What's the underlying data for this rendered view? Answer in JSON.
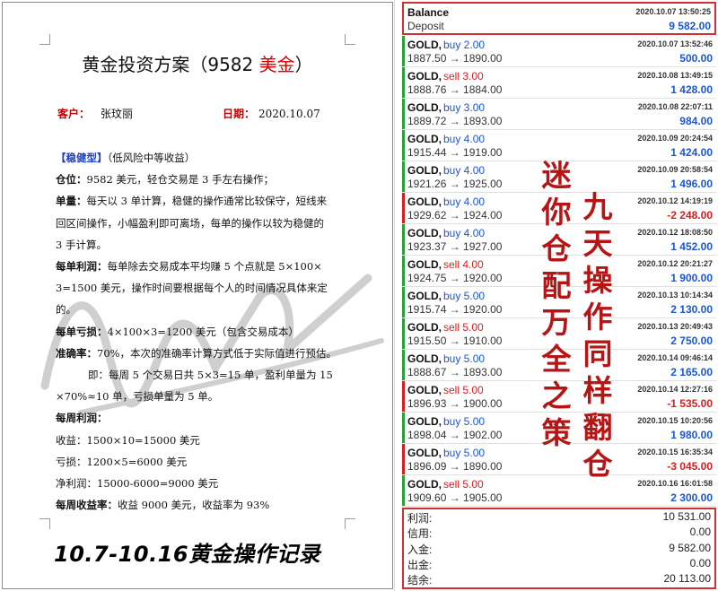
{
  "document": {
    "title_prefix": "黄金投资方案（9582 ",
    "title_red": "美金",
    "title_suffix": "）",
    "client_label": "客户：",
    "client_value": "张玟丽",
    "date_label": "日期：",
    "date_value": "2020.10.07",
    "lines": {
      "plan": "【稳健型】",
      "plan_note": "（低风险中等收益）",
      "position_label": "仓位：",
      "position_text": "9582 美元，轻仓交易是 3 手左右操作；",
      "unit_label": "单量：",
      "unit_text_1": "每天以 3 单计算，稳健的操作通常比较保守，短线来",
      "unit_text_2": "回区间操作，小幅盈利即可离场，每单的操作以较为稳健的",
      "unit_text_3": "3 手计算。",
      "unit_profit_label": "每单利润：",
      "unit_profit_text_1": "每单除去交易成本平均赚 5 个点就是 5×100×",
      "unit_profit_text_2": "3=1500 美元，操作时间要根据每个人的时间情况具体来定",
      "unit_profit_text_3": "的。",
      "unit_loss_label": "每单亏损：",
      "unit_loss_text": "4×100×3=1200 美元（包含交易成本）",
      "accuracy_label": "准确率：",
      "accuracy_text": "70%，本次的准确率计算方式低于实际值进行预估。",
      "accuracy_detail_1": "即：每周 5 个交易日共 5×3=15 单，盈利单量为 15",
      "accuracy_detail_2": "×70%≈10 单，亏损单量为 5 单。",
      "weekly_label": "每周利润：",
      "income": "收益：1500×10=15000 美元",
      "loss": "亏损：1200×5=6000 美元",
      "net": "净利润：15000-6000=9000 美元",
      "weekly_rate_label": "每周收益率：",
      "weekly_rate_text": "收益 9000 美元，收益率为 93%"
    },
    "footer": "10.7-10.16黄金操作记录"
  },
  "calligraphy": {
    "left_column": [
      "迷",
      "你",
      "仓",
      "配",
      "万",
      "全",
      "之",
      "策"
    ],
    "right_column": [
      "九",
      "天",
      "操",
      "作",
      "同",
      "样",
      "翻",
      "仓"
    ]
  },
  "balance": {
    "title": "Balance",
    "subtitle": "Deposit",
    "date": "2020.10.07 13:50:25",
    "amount": "9 582.00"
  },
  "trades": [
    {
      "symbol": "GOLD,",
      "side": "buy 2.00",
      "type": "buy",
      "prices": "1887.50 → 1890.00",
      "date": "2020.10.07 13:52:46",
      "profit": "500.00",
      "positive": true
    },
    {
      "symbol": "GOLD,",
      "side": "sell 3.00",
      "type": "sell",
      "prices": "1888.76 → 1884.00",
      "date": "2020.10.08 13:49:15",
      "profit": "1 428.00",
      "positive": true
    },
    {
      "symbol": "GOLD,",
      "side": "buy 3.00",
      "type": "buy",
      "prices": "1889.72 → 1893.00",
      "date": "2020.10.08 22:07:11",
      "profit": "984.00",
      "positive": true
    },
    {
      "symbol": "GOLD,",
      "side": "buy 4.00",
      "type": "buy",
      "prices": "1915.44 → 1919.00",
      "date": "2020.10.09 20:24:54",
      "profit": "1 424.00",
      "positive": true
    },
    {
      "symbol": "GOLD,",
      "side": "buy 4.00",
      "type": "buy",
      "prices": "1921.26 → 1925.00",
      "date": "2020.10.09 20:58:54",
      "profit": "1 496.00",
      "positive": true
    },
    {
      "symbol": "GOLD,",
      "side": "buy 4.00",
      "type": "buy",
      "prices": "1929.62 → 1924.00",
      "date": "2020.10.12 14:19:19",
      "profit": "-2 248.00",
      "positive": false
    },
    {
      "symbol": "GOLD,",
      "side": "buy 4.00",
      "type": "buy",
      "prices": "1923.37 → 1927.00",
      "date": "2020.10.12 18:08:50",
      "profit": "1 452.00",
      "positive": true
    },
    {
      "symbol": "GOLD,",
      "side": "sell 4.00",
      "type": "sell",
      "prices": "1924.75 → 1920.00",
      "date": "2020.10.12 20:21:27",
      "profit": "1 900.00",
      "positive": true
    },
    {
      "symbol": "GOLD,",
      "side": "buy 5.00",
      "type": "buy",
      "prices": "1915.74 → 1920.00",
      "date": "2020.10.13 10:14:34",
      "profit": "2 130.00",
      "positive": true
    },
    {
      "symbol": "GOLD,",
      "side": "sell 5.00",
      "type": "sell",
      "prices": "1915.50 → 1910.00",
      "date": "2020.10.13 20:49:43",
      "profit": "2 750.00",
      "positive": true
    },
    {
      "symbol": "GOLD,",
      "side": "buy 5.00",
      "type": "buy",
      "prices": "1888.67 → 1893.00",
      "date": "2020.10.14 09:46:14",
      "profit": "2 165.00",
      "positive": true
    },
    {
      "symbol": "GOLD,",
      "side": "sell 5.00",
      "type": "sell",
      "prices": "1896.93 → 1900.00",
      "date": "2020.10.14 12:27:16",
      "profit": "-1 535.00",
      "positive": false
    },
    {
      "symbol": "GOLD,",
      "side": "buy 5.00",
      "type": "buy",
      "prices": "1898.04 → 1902.00",
      "date": "2020.10.15 10:20:56",
      "profit": "1 980.00",
      "positive": true
    },
    {
      "symbol": "GOLD,",
      "side": "buy 5.00",
      "type": "buy",
      "prices": "1896.09 → 1890.00",
      "date": "2020.10.15 16:35:34",
      "profit": "-3 045.00",
      "positive": false
    },
    {
      "symbol": "GOLD,",
      "side": "sell 5.00",
      "type": "sell",
      "prices": "1909.60 → 1905.00",
      "date": "2020.10.16 16:01:58",
      "profit": "2 300.00",
      "positive": true
    }
  ],
  "summary": [
    {
      "label": "利润:",
      "value": "10 531.00"
    },
    {
      "label": "信用:",
      "value": "0.00"
    },
    {
      "label": "入金:",
      "value": "9 582.00"
    },
    {
      "label": "出金:",
      "value": "0.00"
    },
    {
      "label": "结余:",
      "value": "20 113.00"
    }
  ],
  "colors": {
    "buy": "#1a56d6",
    "sell": "#d42020",
    "profit_positive": "#1a56d6",
    "profit_negative": "#d42020",
    "accent_positive": "#2e9e3a",
    "accent_negative": "#d42020",
    "box_border": "#d23030"
  }
}
